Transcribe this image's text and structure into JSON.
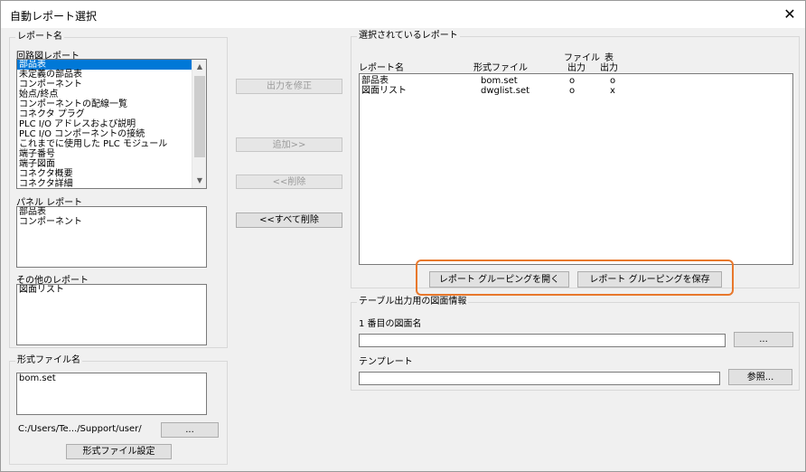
{
  "window": {
    "title": "自動レポート選択",
    "close_label": "✕"
  },
  "report_name_group": {
    "label": "レポート名"
  },
  "circuit": {
    "label": "回路図レポート",
    "items": [
      "部品表",
      "未定義の部品表",
      "コンポーネント",
      "始点/終点",
      "コンポーネントの配線一覧",
      "コネクタ プラグ",
      "PLC I/O アドレスおよび説明",
      "PLC I/O コンポーネントの接続",
      "これまでに使用した PLC モジュール",
      "端子番号",
      "端子図面",
      "コネクタ概要",
      "コネクタ詳細"
    ]
  },
  "panel": {
    "label": "パネル レポート",
    "items": [
      "部品表",
      "コンポーネント"
    ]
  },
  "other": {
    "label": "その他のレポート",
    "items": [
      "図面リスト"
    ]
  },
  "format_group": {
    "label": "形式ファイル名",
    "items": [
      "bom.set"
    ],
    "path": "C:/Users/Te.../Support/user/",
    "browse_label": "...",
    "settings_label": "形式ファイル設定"
  },
  "middle": {
    "modify_label": "出力を修正",
    "add_label": "追加>>",
    "remove_label": "<<削除",
    "remove_all_label": "<<すべて削除"
  },
  "selected": {
    "label": "選択されているレポート",
    "headers": {
      "name": "レポート名",
      "format": "形式ファイル",
      "file_out_1": "ファイル",
      "file_out_2": "出力",
      "table_out_1": "表",
      "table_out_2": "出力"
    },
    "rows": [
      {
        "name": "部品表",
        "format": "bom.set",
        "file": "o",
        "table": "o"
      },
      {
        "name": "図面リスト",
        "format": "dwglist.set",
        "file": "o",
        "table": "x"
      }
    ],
    "open_grouping_label": "レポート グルーピングを開く",
    "save_grouping_label": "レポート グルーピングを保存"
  },
  "table_info": {
    "label": "テーブル出力用の図面情報",
    "drawing_label": "1 番目の図面名",
    "drawing_value": "",
    "drawing_browse_label": "...",
    "template_label": "テンプレート",
    "template_value": "",
    "template_browse_label": "参照..."
  },
  "colors": {
    "selection": "#0078d7",
    "highlight": "#e8782c"
  }
}
